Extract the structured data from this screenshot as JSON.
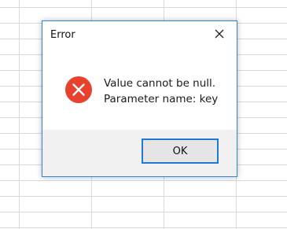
{
  "dialog": {
    "title": "Error",
    "message_line1": "Value cannot be null.",
    "message_line2": "Parameter name: key",
    "ok_label": "OK",
    "icon": "error-icon",
    "close_icon": "close-icon"
  },
  "colors": {
    "accent": "#2f86d7",
    "error_red": "#e8412d",
    "footer_bg": "#f0f0f0"
  }
}
